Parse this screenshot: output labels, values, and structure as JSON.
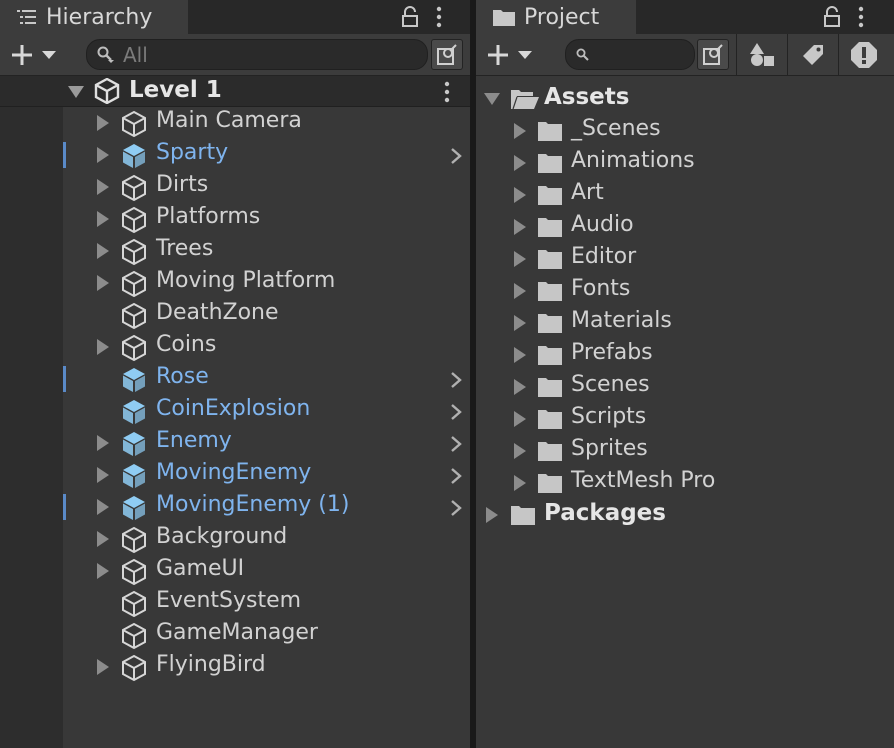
{
  "hierarchy": {
    "tab_label": "Hierarchy",
    "search_placeholder": "All",
    "scene_name": "Level 1",
    "items": [
      {
        "name": "Main Camera",
        "expandable": true,
        "prefab": false,
        "marked": false
      },
      {
        "name": "Sparty",
        "expandable": true,
        "prefab": true,
        "marked": true
      },
      {
        "name": "Dirts",
        "expandable": true,
        "prefab": false,
        "marked": false
      },
      {
        "name": "Platforms",
        "expandable": true,
        "prefab": false,
        "marked": false
      },
      {
        "name": "Trees",
        "expandable": true,
        "prefab": false,
        "marked": false
      },
      {
        "name": "Moving Platform",
        "expandable": true,
        "prefab": false,
        "marked": false
      },
      {
        "name": "DeathZone",
        "expandable": false,
        "prefab": false,
        "marked": false
      },
      {
        "name": "Coins",
        "expandable": true,
        "prefab": false,
        "marked": false
      },
      {
        "name": "Rose",
        "expandable": false,
        "prefab": true,
        "marked": true
      },
      {
        "name": "CoinExplosion",
        "expandable": false,
        "prefab": true,
        "marked": false
      },
      {
        "name": "Enemy",
        "expandable": true,
        "prefab": true,
        "marked": false
      },
      {
        "name": "MovingEnemy",
        "expandable": true,
        "prefab": true,
        "marked": false
      },
      {
        "name": "MovingEnemy (1)",
        "expandable": true,
        "prefab": true,
        "marked": true
      },
      {
        "name": "Background",
        "expandable": true,
        "prefab": false,
        "marked": false
      },
      {
        "name": "GameUI",
        "expandable": true,
        "prefab": false,
        "marked": false
      },
      {
        "name": "EventSystem",
        "expandable": false,
        "prefab": false,
        "marked": false
      },
      {
        "name": "GameManager",
        "expandable": false,
        "prefab": false,
        "marked": false
      },
      {
        "name": "FlyingBird",
        "expandable": true,
        "prefab": false,
        "marked": false
      }
    ]
  },
  "project": {
    "tab_label": "Project",
    "search_value": "",
    "assets_label": "Assets",
    "folders": [
      "_Scenes",
      "Animations",
      "Art",
      "Audio",
      "Editor",
      "Fonts",
      "Materials",
      "Prefabs",
      "Scenes",
      "Scripts",
      "Sprites",
      "TextMesh Pro"
    ],
    "packages_label": "Packages"
  },
  "colors": {
    "panel_bg": "#383838",
    "prefab_text": "#7fb4ee",
    "prefab_icon": "#8fccf3",
    "text": "#d2d2d2",
    "override_mark": "#5a8ac8"
  }
}
